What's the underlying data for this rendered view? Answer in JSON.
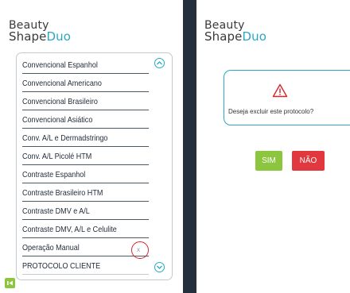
{
  "logo": {
    "line1": "Beauty",
    "line2_prefix": "Shape",
    "line2_accent": "Duo"
  },
  "protocol_list": {
    "items": [
      "Convencional Espanhol",
      "Convencional Americano",
      "Convencional Brasileiro",
      "Convencional Asiático",
      "Conv. A/L e Dermadstringo",
      "Conv. A/L Picolé HTM",
      "Contraste Espanhol",
      "Contraste Brasileiro HTM",
      "Contraste DMV e A/L",
      "Contraste DMV, A/L e Celulite",
      "Operação Manual",
      "PROTOCOLO CLIENTE"
    ],
    "delete_mark": "x"
  },
  "dialog": {
    "message": "Deseja excluir este protocolo?",
    "confirm_label": "SIM",
    "cancel_label": "NÃO"
  },
  "colors": {
    "accent": "#2aa6c4",
    "confirm": "#8cc63f",
    "cancel": "#e0383e",
    "warning": "#d6262b",
    "divider": "#24313d"
  }
}
